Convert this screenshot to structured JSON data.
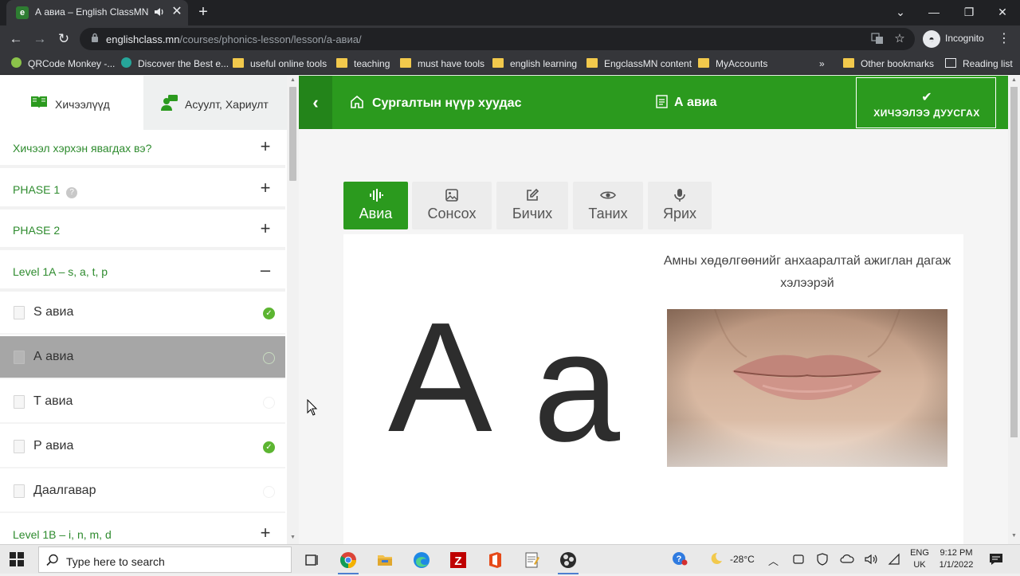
{
  "browser": {
    "tab_title": "А авиа – English ClassMN",
    "tab_favicon": "e",
    "url_domain": "englishclass.mn",
    "url_path": "/courses/phonics-lesson/lesson/а-авиа/",
    "profile_label": "Incognito",
    "bookmarks": [
      {
        "label": "QRCode Monkey -...",
        "icon": "qr-icon"
      },
      {
        "label": "Discover the Best e...",
        "icon": "site-icon"
      },
      {
        "label": "useful online tools",
        "icon": "folder-icon"
      },
      {
        "label": "teaching",
        "icon": "folder-icon"
      },
      {
        "label": "must have tools",
        "icon": "folder-icon"
      },
      {
        "label": "english learning",
        "icon": "folder-icon"
      },
      {
        "label": "EngclassMN content",
        "icon": "folder-icon"
      },
      {
        "label": "MyAccounts",
        "icon": "folder-icon"
      }
    ],
    "bookmarks_overflow": "»",
    "other_bookmarks": "Other bookmarks",
    "reading_list": "Reading list"
  },
  "sidebar": {
    "tabs": [
      {
        "label": "Хичээлүүд",
        "icon": "book-icon"
      },
      {
        "label": "Асуулт, Хариулт",
        "icon": "chat-user-icon"
      }
    ],
    "sections": [
      {
        "label": "Хичээл хэрхэн явагдах вэ?",
        "toggle": "+"
      },
      {
        "label": "PHASE 1",
        "toggle": "+",
        "help": "?"
      },
      {
        "label": "PHASE 2",
        "toggle": "+"
      },
      {
        "label": "Level 1A – s, a, t, p",
        "toggle": "–"
      }
    ],
    "items": [
      {
        "label": "S авиа",
        "status": "done"
      },
      {
        "label": "А авиа",
        "status": "current"
      },
      {
        "label": "Т авиа",
        "status": "pending"
      },
      {
        "label": "Р авиа",
        "status": "done"
      },
      {
        "label": "Даалгавар",
        "status": "pending"
      }
    ],
    "next_section": {
      "label": "Level 1B – i, n, m, d",
      "toggle": "+"
    }
  },
  "header": {
    "back_icon": "chevron-left-icon",
    "home_label": "Сургалтын нүүр хуудас",
    "current_lesson": "А авиа",
    "finish_label": "ХИЧЭЭЛЭЭ ДУУСГАХ"
  },
  "steps": [
    {
      "label": "Авиа",
      "icon": "soundwave-icon",
      "active": true
    },
    {
      "label": "Сонсох",
      "icon": "image-icon",
      "active": false
    },
    {
      "label": "Бичих",
      "icon": "edit-icon",
      "active": false
    },
    {
      "label": "Таних",
      "icon": "eye-icon",
      "active": false
    },
    {
      "label": "Ярих",
      "icon": "microphone-icon",
      "active": false
    }
  ],
  "content": {
    "letter_upper": "A",
    "letter_lower": "a",
    "instruction": "Амны хөдөлгөөнийг анхааралтай ажиглан дагаж хэлээрэй"
  },
  "taskbar": {
    "search_placeholder": "Type here to search",
    "weather": "-28°C",
    "lang_line1": "ENG",
    "lang_line2": "UK",
    "time": "9:12 PM",
    "date": "1/1/2022"
  },
  "colors": {
    "brand_green": "#2b9a1e",
    "section_text": "#2e8b2e",
    "done_check": "#5cb531"
  }
}
